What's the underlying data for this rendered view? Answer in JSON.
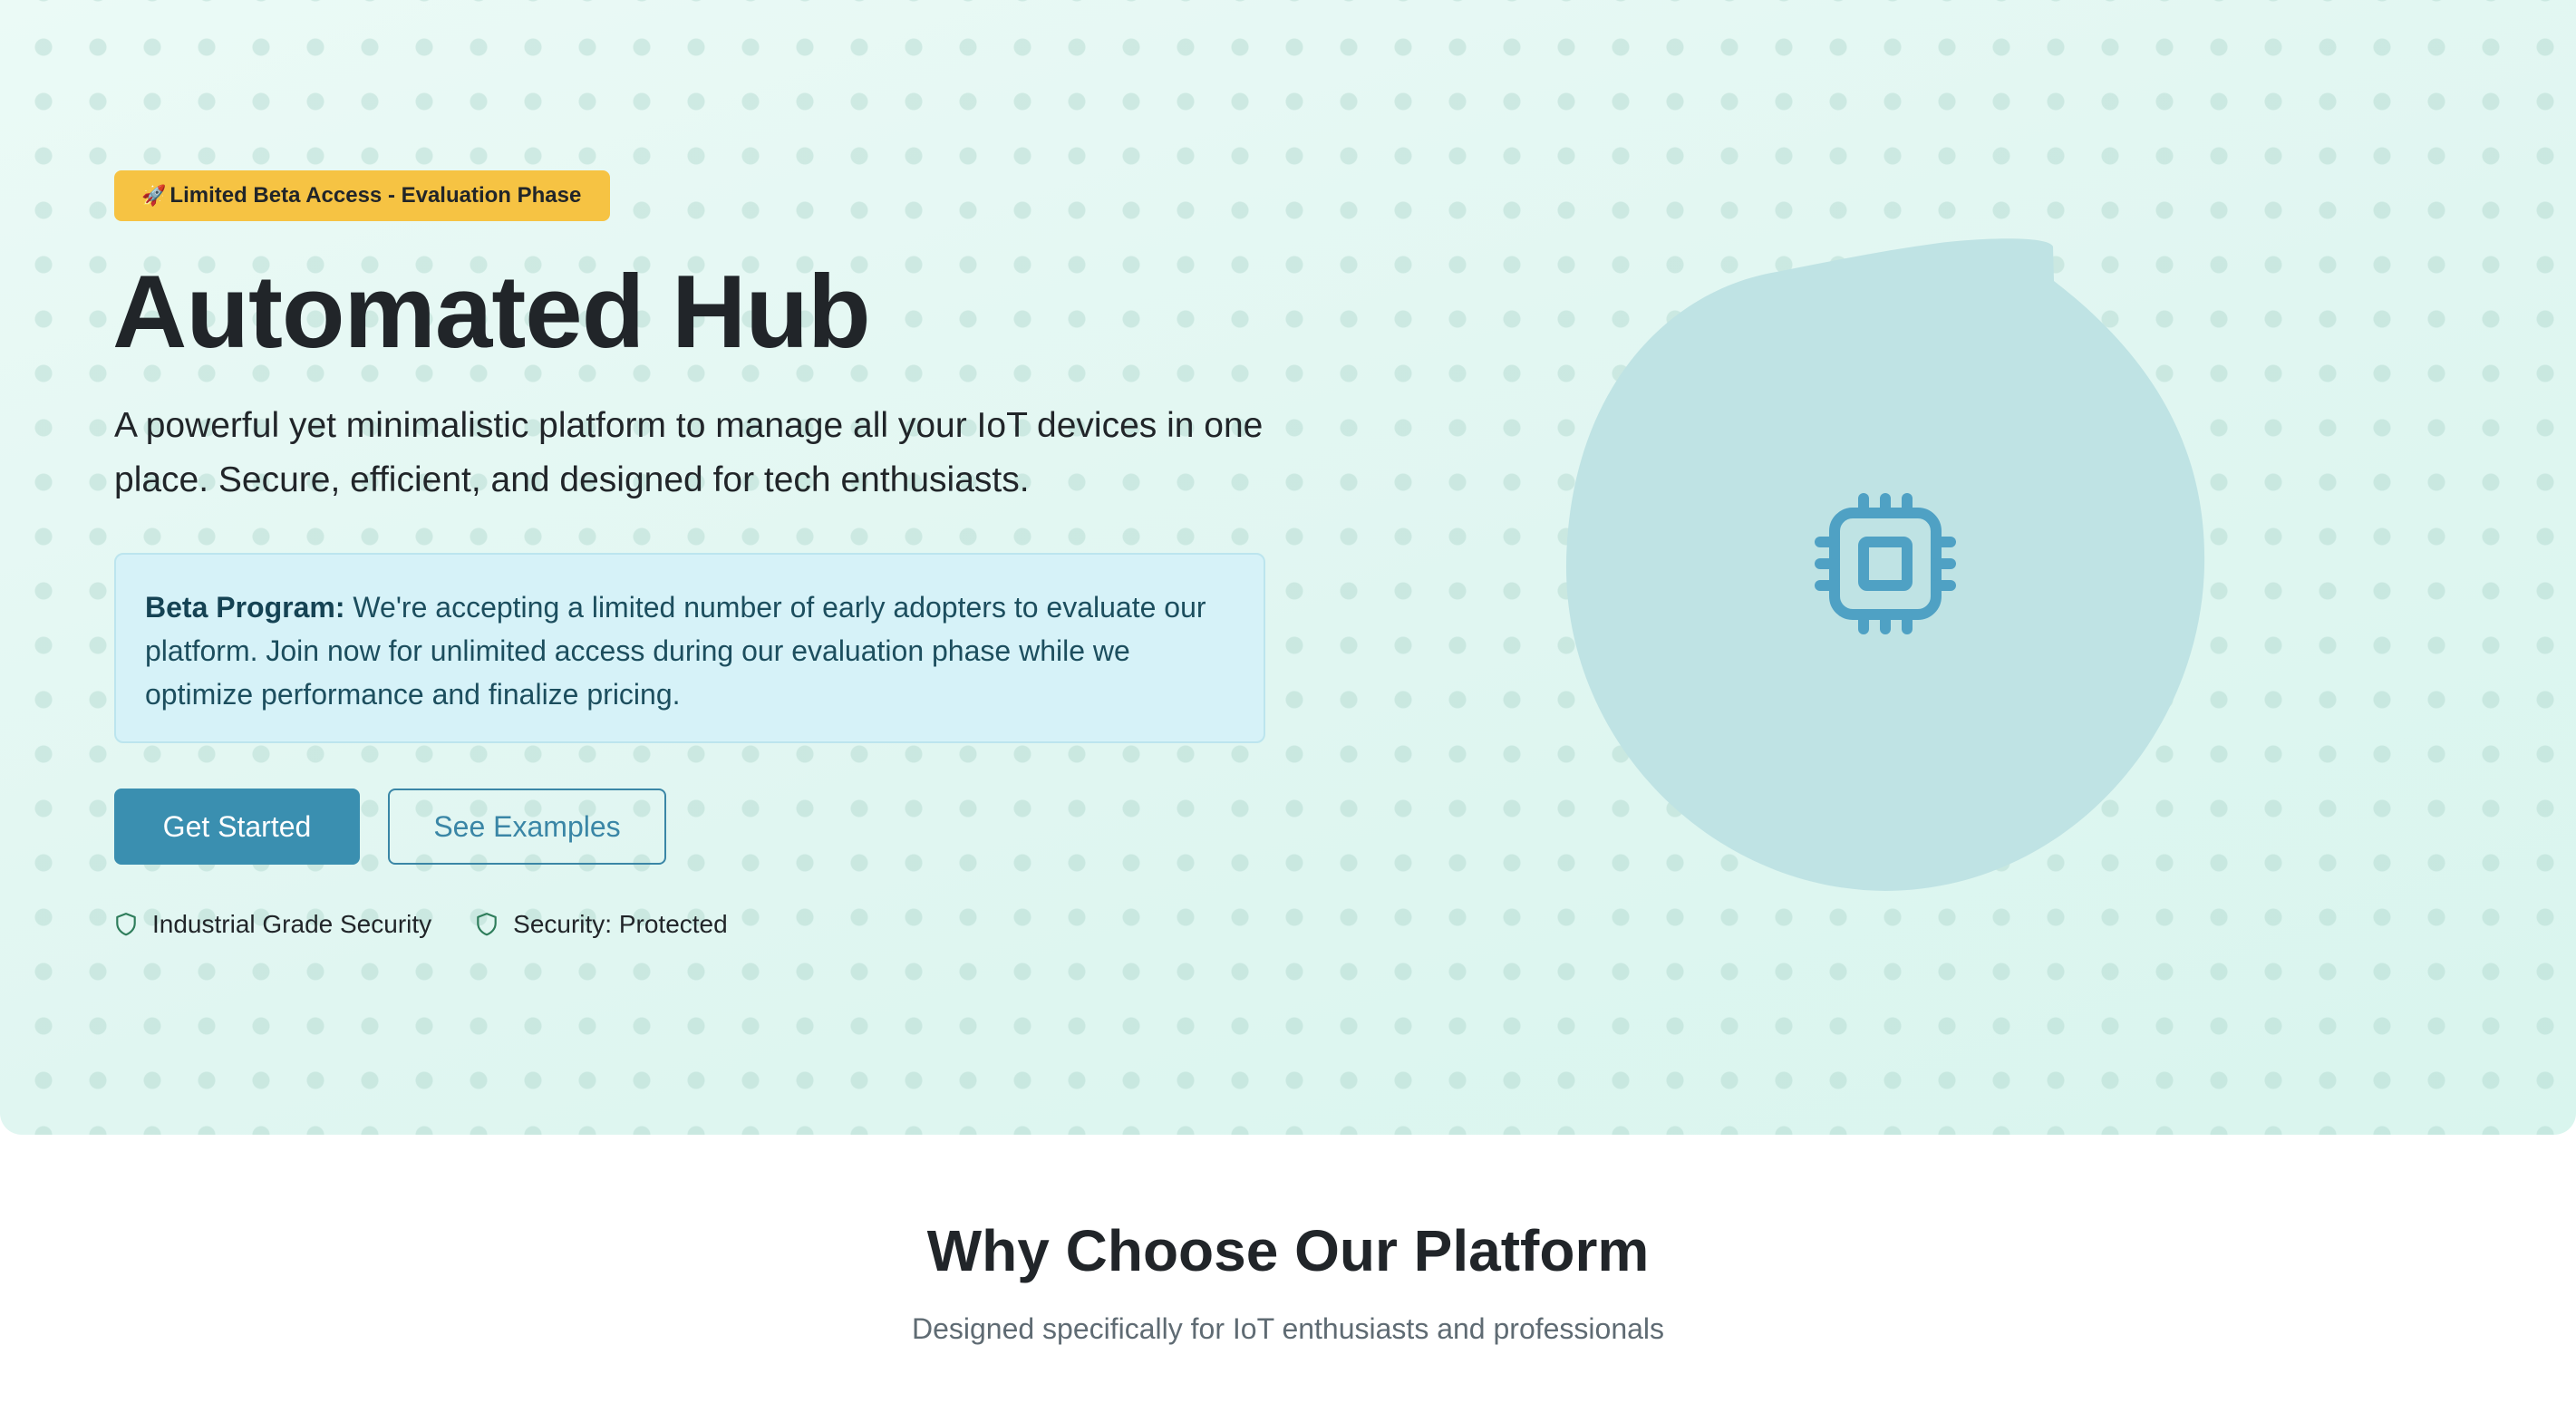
{
  "hero": {
    "badge": {
      "icon": "rocket-icon",
      "label": "Limited Beta Access - Evaluation Phase",
      "color": "#f6c343"
    },
    "title": "Automated Hub",
    "lead": "A powerful yet minimalistic platform to manage all your IoT devices in one place. Secure, efficient, and designed for tech enthusiasts.",
    "beta_notice": {
      "label": "Beta Program:",
      "text": "We're accepting a limited number of early adopters to evaluate our platform. Join now for unlimited access during our evaluation phase while we optimize performance and finalize pricing."
    },
    "buttons": {
      "primary": "Get Started",
      "secondary": "See Examples"
    },
    "features": [
      {
        "icon": "shield-icon",
        "label": "Industrial Grade Security"
      },
      {
        "icon": "shield-icon",
        "label": "Security: Protected"
      }
    ],
    "illustration_icon": "cpu-chip-icon"
  },
  "why_section": {
    "title": "Why Choose Our Platform",
    "subtitle": "Designed specifically for IoT enthusiasts and professionals"
  },
  "colors": {
    "accent": "#3a8fb0",
    "hero_background": "#e6f9f4",
    "badge": "#f6c343",
    "notice_background": "#d6f2f8",
    "feature_icon": "#2e7d5b"
  }
}
